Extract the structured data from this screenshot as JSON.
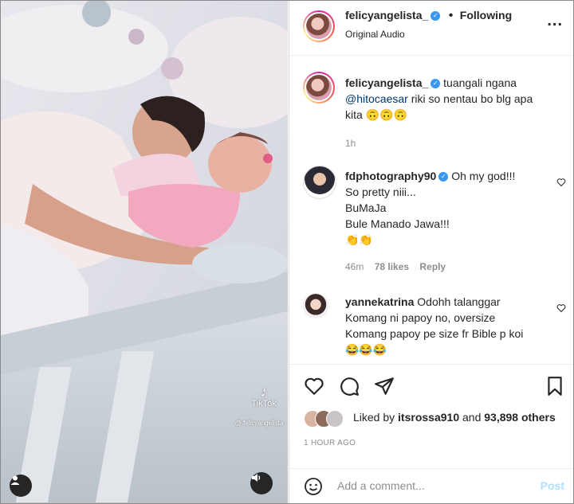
{
  "header": {
    "username": "felicyangelista_",
    "separator": "•",
    "follow_status": "Following",
    "audio": "Original Audio",
    "more": "..."
  },
  "caption": {
    "username": "felicyangelista_",
    "text_line1": "tuangali ngana",
    "mention": "@hitocaesar",
    "text_line2": "riki so nentau bo blg apa",
    "text_line3": "kita",
    "emojis": "🙃🙃🙃",
    "time": "1h"
  },
  "comments": [
    {
      "username": "fdphotography90",
      "lines": [
        "Oh my god!!!",
        "So pretty niii...",
        "BuMaJa",
        "Bule Manado Jawa!!!"
      ],
      "emojis": "👏👏",
      "time": "46m",
      "likes": "78 likes",
      "reply": "Reply"
    },
    {
      "username": "yannekatrina",
      "lines": [
        "Odohh talanggar",
        "Komang ni papoy no, oversize",
        "Komang papoy pe size fr Bible p koi"
      ],
      "emojis": "😂😂😂"
    }
  ],
  "post": {
    "liked_by_prefix": "Liked by",
    "liked_by_user": "itsrossa910",
    "liked_by_suffix": "and",
    "others": "93,898 others",
    "timestamp": "1 HOUR AGO"
  },
  "add_comment": {
    "placeholder": "Add a comment...",
    "post_label": "Post"
  },
  "media": {
    "watermark_logo": "TikTok",
    "watermark_handle": "@ felicyangelista"
  },
  "colors": {
    "verified": "#3897f0",
    "post_disabled": "#b2dffc",
    "meta": "#8e8e8e"
  }
}
